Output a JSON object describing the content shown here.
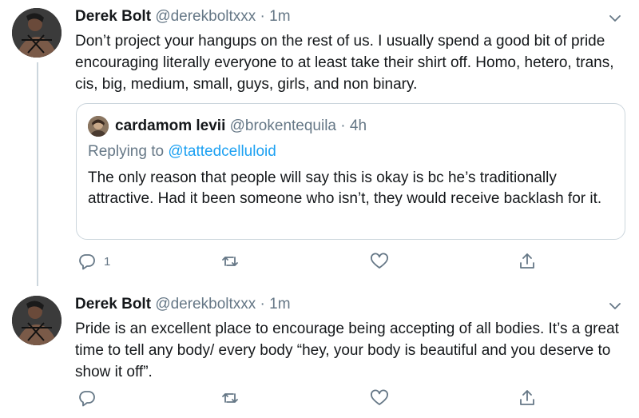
{
  "tweets": [
    {
      "name": "Derek Bolt",
      "handle": "@derekboltxxx",
      "separator": "·",
      "time": "1m",
      "text": "Don’t project your hangups on the rest of us. I usually spend a good bit of pride encouraging literally everyone to at least take their shirt off. Homo, hetero, trans, cis, big, medium, small, guys, girls, and non binary.",
      "quote": {
        "name": "cardamom levii",
        "handle": "@brokentequila",
        "separator": "·",
        "time": "4h",
        "replying_prefix": "Replying to",
        "replying_to": "@tattedcelluloid",
        "text": "The only reason that people will say this is okay is bc he’s traditionally attractive. Had it been someone who isn’t, they would receive backlash for it."
      },
      "reply_count": "1",
      "icons": [
        "reply-icon",
        "retweet-icon",
        "like-icon",
        "share-icon",
        "chevron-down-icon"
      ]
    },
    {
      "name": "Derek Bolt",
      "handle": "@derekboltxxx",
      "separator": "·",
      "time": "1m",
      "text": "Pride is an excellent place to encourage being accepting of all bodies. It’s a great time to tell any body/ every body “hey, your body is beautiful and you deserve to show it off”.",
      "reply_count": "",
      "icons": [
        "reply-icon",
        "retweet-icon",
        "like-icon",
        "share-icon",
        "chevron-down-icon"
      ]
    }
  ],
  "colors": {
    "text": "#14171a",
    "secondary": "#657786",
    "link": "#1da1f2",
    "border": "#ccd6dd"
  }
}
